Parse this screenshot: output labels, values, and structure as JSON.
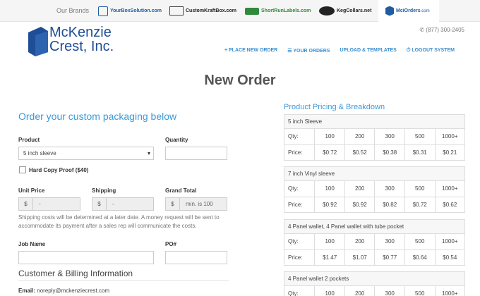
{
  "brands_bar": {
    "label": "Our Brands",
    "items": [
      {
        "name": "YourBoxSolution.com"
      },
      {
        "name": "CustomKraftBox.com"
      },
      {
        "name": "ShortRunLabels.com"
      },
      {
        "name": "KegCollars.net"
      },
      {
        "name": "MciOrders",
        "suffix": ".com"
      }
    ]
  },
  "header": {
    "logo_line1": "McKenzie",
    "logo_line2": "Crest, Inc.",
    "phone": "(877) 300-2405",
    "nav": [
      {
        "label": "PLACE NEW ORDER",
        "icon": "plus-icon"
      },
      {
        "label": "YOUR ORDERS",
        "icon": "list-icon"
      },
      {
        "label": "UPLOAD & TEMPLATES"
      },
      {
        "label": "LOGOUT SYSTEM",
        "icon": "power-icon"
      }
    ]
  },
  "page_title": "New Order",
  "form": {
    "section_title": "Order your custom packaging below",
    "product_label": "Product",
    "product_value": "5 inch sleeve",
    "quantity_label": "Quantity",
    "quantity_value": "",
    "hard_copy_label": "Hard Copy Proof ($40)",
    "unit_price_label": "Unit Price",
    "unit_price_prefix": "$",
    "unit_price_value": "-",
    "shipping_label": "Shipping",
    "shipping_prefix": "$",
    "shipping_value": "-",
    "grand_total_label": "Grand Total",
    "grand_total_prefix": "$",
    "grand_total_value": "min. is 100",
    "shipping_note": "Shipping costs will be determined at a later date. A money request will be sent to accommodate its payment after a sales rep will communicate the costs.",
    "job_name_label": "Job Name",
    "po_label": "PO#",
    "billing_title": "Customer & Billing Information",
    "email_label": "Email:",
    "email_value": "noreply@mckenziecrest.com"
  },
  "pricing": {
    "title": "Product Pricing & Breakdown",
    "tables": [
      {
        "name": "5 inch Sleeve",
        "qty_label": "Qty:",
        "price_label": "Price:",
        "qty": [
          "100",
          "200",
          "300",
          "500",
          "1000+"
        ],
        "prices": [
          "$0.72",
          "$0.52",
          "$0.38",
          "$0.31",
          "$0.21"
        ]
      },
      {
        "name": "7 inch Vinyl sleeve",
        "qty_label": "Qty:",
        "price_label": "Price:",
        "qty": [
          "100",
          "200",
          "300",
          "500",
          "1000+"
        ],
        "prices": [
          "$0.92",
          "$0.92",
          "$0.82",
          "$0.72",
          "$0.62"
        ]
      },
      {
        "name": "4 Panel wallet, 4 Panel wallet with tube pocket",
        "qty_label": "Qty:",
        "price_label": "Price:",
        "qty": [
          "100",
          "200",
          "300",
          "500",
          "1000+"
        ],
        "prices": [
          "$1.47",
          "$1.07",
          "$0.77",
          "$0.64",
          "$0.54"
        ]
      },
      {
        "name": "4 Panel wallet 2 pockets",
        "qty_label": "Qty:",
        "price_label": "Price:",
        "qty": [
          "100",
          "200",
          "300",
          "500",
          "1000+"
        ],
        "prices": [
          "",
          "",
          "",
          "",
          ""
        ]
      }
    ]
  },
  "colors": {
    "accent": "#3a9ad9",
    "brand_blue": "#1f4e96"
  }
}
